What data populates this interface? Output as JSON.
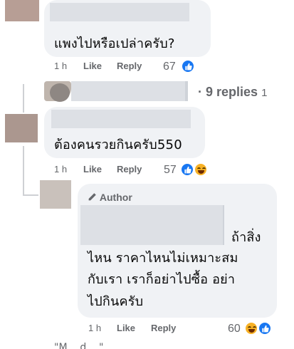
{
  "comments": [
    {
      "text": "แพงไปหรือเปล่าครับ?",
      "time": "1 h",
      "like_label": "Like",
      "reply_label": "Reply",
      "reaction_count": "67"
    },
    {
      "text": "ต้องคนรวยกินครับ550",
      "time": "1 h",
      "like_label": "Like",
      "reply_label": "Reply",
      "reaction_count": "57"
    }
  ],
  "replies_link": {
    "dot": "·",
    "label": "9 replies",
    "trail": "1"
  },
  "author_reply": {
    "badge": "Author",
    "lines": [
      "ถ้าสิ่ง",
      "ไหน ราคาไหนไม่เหมาะสม",
      "กับเรา เราก็อย่าไปซื้อ อย่า",
      "ไปกินครับ"
    ],
    "time": "1 h",
    "like_label": "Like",
    "reply_label": "Reply",
    "reaction_count": "60"
  },
  "cut_off_text": "\"M... d... \"... ... ... ...",
  "colors": {
    "like_blue": "#1877f2",
    "haha_yellow": "#f7b125",
    "bubble_bg": "#f0f2f5",
    "meta_gray": "#65676b"
  }
}
